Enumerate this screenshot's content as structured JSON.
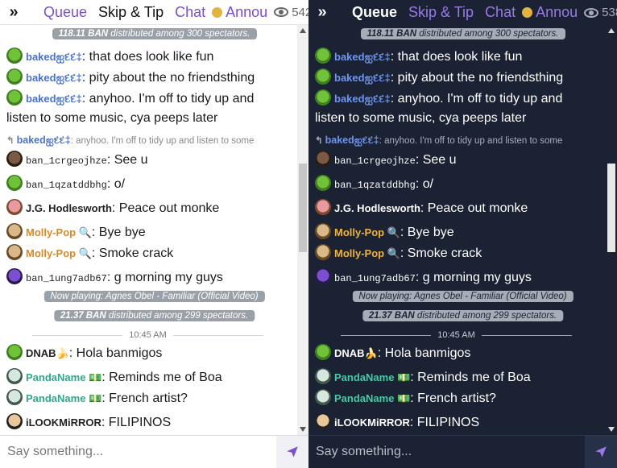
{
  "header": {
    "collapse_icon": "chevrons-right-icon",
    "tabs": {
      "queue": "Queue",
      "skip": "Skip & Tip",
      "chat": "Chat",
      "annou": "Annou"
    },
    "viewers_light": "542",
    "viewers_dark": "538"
  },
  "messages": {
    "pill_top": {
      "amount": "118.11 BAN",
      "text": "distributed among 300 spectators."
    },
    "m1": {
      "name": "bakedஐદદ‡",
      "text": ": that does look like fun"
    },
    "m2": {
      "name": "bakedஐદદ‡",
      "text": ": pity about the no friendsthing"
    },
    "m3": {
      "name": "bakedஐદદ‡",
      "text": ": anyhoo. I'm off to tidy up and listen to some music, cya peeps later"
    },
    "reply": {
      "name": "bakedஐદદ‡",
      "text": ": anyhoo. I'm off to tidy up and listen to some"
    },
    "m4": {
      "name": "ban_1crgeojhze",
      "text": ": See u"
    },
    "m5": {
      "name": "ban_1qzatddbhg",
      "text": ": o/"
    },
    "m6": {
      "name": "J.G. Hodlesworth",
      "text": ": Peace out monke"
    },
    "m7": {
      "name": "Molly-Pop 🔍",
      "text": ": Bye bye"
    },
    "m8": {
      "name": "Molly-Pop 🔍",
      "text": ": Smoke crack"
    },
    "m9": {
      "name": "ban_1ung7adb67",
      "text": ": g morning my guys"
    },
    "pill_playing": {
      "text": "Now playing: Agnes Obel - Familiar (Official Video)"
    },
    "pill_mid": {
      "amount": "21.37 BAN",
      "text": "distributed among 299 spectators."
    },
    "time": "10:45 AM",
    "m10": {
      "name": "DNAB🍌",
      "text": ": Hola banmigos"
    },
    "m11": {
      "name": "PandaName 💵",
      "text": ": Reminds me of Boa"
    },
    "m12": {
      "name": "PandaName 💵",
      "text": ": French artist?"
    },
    "m13": {
      "name": "iLOOKMiRROR",
      "text": ": FILIPINOS"
    }
  },
  "input": {
    "placeholder": "Say something...",
    "send_icon": "send-icon"
  },
  "colors": {
    "accent": "#7a4fd0",
    "dark_bg": "#1b2233",
    "announce_dot": "#e3b341"
  }
}
